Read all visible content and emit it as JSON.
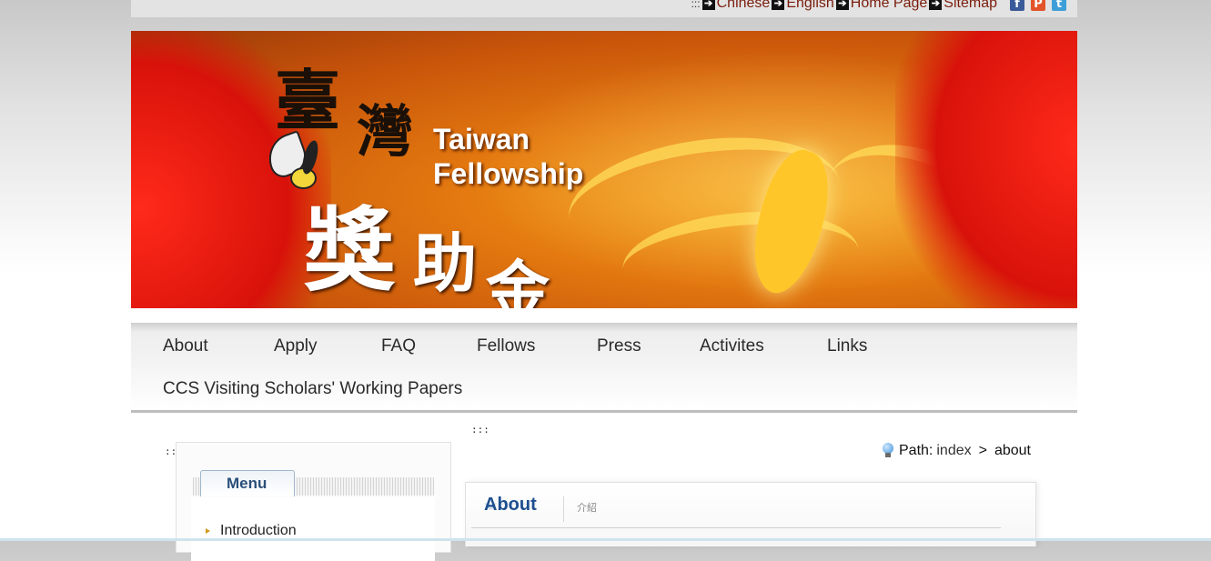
{
  "topbar": {
    "accesskey": ":::",
    "links": [
      "Chinese",
      "English",
      "Home Page",
      "Sitemap"
    ],
    "social": [
      {
        "name": "facebook",
        "glyph": "f"
      },
      {
        "name": "plurk",
        "glyph": "P"
      },
      {
        "name": "twitter",
        "glyph": "t"
      }
    ]
  },
  "banner": {
    "title_line1": "Taiwan",
    "title_line2": "Fellowship",
    "cjk": [
      "臺",
      "灣",
      "獎",
      "助",
      "金"
    ]
  },
  "nav": {
    "items": [
      "About",
      "Apply",
      "FAQ",
      "Fellows",
      "Press",
      "Activites",
      "Links",
      "CCS Visiting Scholars' Working Papers"
    ]
  },
  "sidebar": {
    "accesskey": ":::",
    "menu_label": "Menu",
    "items": [
      "Introduction"
    ]
  },
  "main": {
    "accesskey": ":::",
    "path_label": "Path:",
    "path": [
      "index",
      "about"
    ],
    "path_sep": ">",
    "title": "About",
    "subtitle": "介紹"
  },
  "colors": {
    "nav_text": "#2a2a2a",
    "link_dark_red": "#7a1c0c",
    "title_blue": "#1d4f8f"
  }
}
